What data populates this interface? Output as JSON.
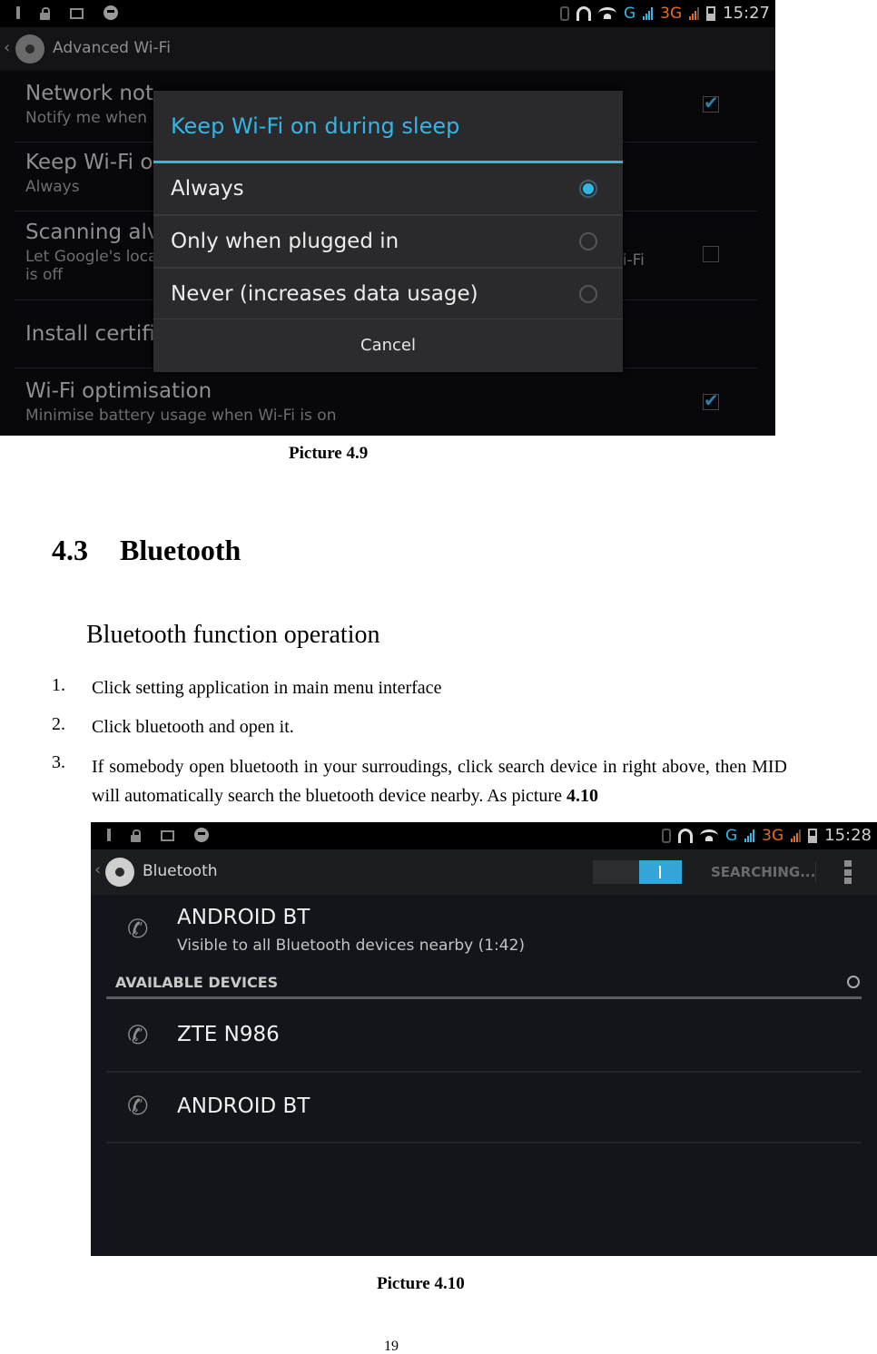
{
  "screenshot1": {
    "status_bar": {
      "left_icons": [
        "usb-debug-icon",
        "lock-icon",
        "screenshot-icon",
        "hangouts-icon"
      ],
      "right_icons": [
        "bluetooth-icon",
        "headset-icon",
        "wifi-icon",
        "g-signal-icon",
        "3g-signal-icon",
        "battery-icon"
      ],
      "g_label": "G",
      "threeg_label": "3G",
      "time": "15:27"
    },
    "action_bar": {
      "back": "‹",
      "title": "Advanced Wi-Fi"
    },
    "preferences": [
      {
        "title": "Network notification",
        "visible_title": "Network not",
        "summary": "Notify me when",
        "checked": true
      },
      {
        "title": "Keep Wi-Fi on during sleep",
        "visible_title": "Keep Wi-Fi o",
        "summary": "Always"
      },
      {
        "title": "Scanning always available",
        "visible_title": "Scanning alv",
        "summary_line1": "Let Google's loca",
        "summary_line2": "is off",
        "right_fragment": "/i-Fi",
        "checked": false
      },
      {
        "title": "Install certificates",
        "visible_title": "Install certifi"
      },
      {
        "title": "Wi-Fi optimisation",
        "summary": "Minimise battery usage when Wi-Fi is on",
        "checked": true
      }
    ],
    "dialog": {
      "title": "Keep Wi-Fi on during sleep",
      "options": [
        {
          "label": "Always",
          "selected": true
        },
        {
          "label": "Only when plugged in",
          "selected": false
        },
        {
          "label": "Never (increases data usage)",
          "selected": false
        }
      ],
      "cancel_label": "Cancel"
    },
    "accent_color": "#33b5e5"
  },
  "caption1": "Picture 4.9",
  "section": {
    "number": "4.3",
    "title": "Bluetooth"
  },
  "subheading": "Bluetooth function operation",
  "steps": [
    {
      "n": "1.",
      "text": "Click setting application in main menu interface"
    },
    {
      "n": "2.",
      "text": "Click bluetooth and open it."
    },
    {
      "n": "3.",
      "text": "If somebody open bluetooth in your surroudings, click search device in right above, then MID will automatically search the bluetooth device nearby. As picture ",
      "bold_ref": "4.10"
    }
  ],
  "screenshot2": {
    "status_bar": {
      "g_label": "G",
      "threeg_label": "3G",
      "time": "15:28"
    },
    "action_bar": {
      "back": "‹",
      "title": "Bluetooth",
      "switch_on": true,
      "search_label": "SEARCHING...",
      "overflow": "overflow-menu-icon"
    },
    "this_device": {
      "name": "ANDROID BT",
      "status": "Visible to all Bluetooth devices nearby (1:42)"
    },
    "available_header": "AVAILABLE DEVICES",
    "available_devices": [
      {
        "name": "ZTE N986"
      },
      {
        "name": "ANDROID BT"
      }
    ]
  },
  "caption2": "Picture 4.10",
  "page_number": "19"
}
